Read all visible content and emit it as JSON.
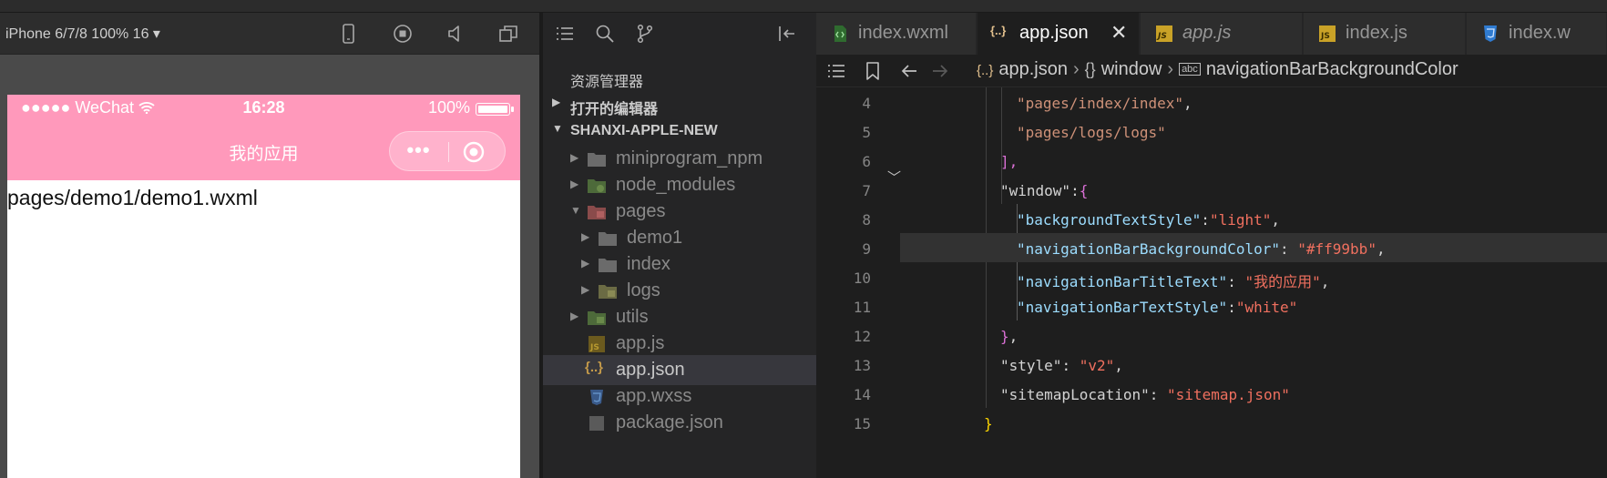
{
  "simulator": {
    "device": "iPhone 6/7/8 100% 16 ▾",
    "status_bar": {
      "signal": "●●●●● WeChat",
      "time": "16:28",
      "battery": "100%"
    },
    "nav_title": "我的应用",
    "page_text": "pages/demo1/demo1.wxml",
    "capsule": {
      "more": "•••"
    }
  },
  "explorer": {
    "title": "资源管理器",
    "open_editors": "打开的编辑器",
    "project": "SHANXI-APPLE-NEW",
    "tree": [
      {
        "label": "miniprogram_npm"
      },
      {
        "label": "node_modules"
      },
      {
        "label": "pages"
      },
      {
        "label": "demo1"
      },
      {
        "label": "index"
      },
      {
        "label": "logs"
      },
      {
        "label": "utils"
      },
      {
        "label": "app.js"
      },
      {
        "label": "app.json"
      },
      {
        "label": "app.wxss"
      },
      {
        "label": "package.json"
      }
    ]
  },
  "editor": {
    "tabs": [
      {
        "label": "index.wxml"
      },
      {
        "label": "app.json"
      },
      {
        "label": "app.js"
      },
      {
        "label": "index.js"
      },
      {
        "label": "index.w"
      }
    ],
    "breadcrumb": [
      "app.json",
      "window",
      "navigationBarBackgroundColor"
    ],
    "lines": [
      {
        "n": "4",
        "parts": [
          {
            "t": "\"pages/index/index\"",
            "c": "s"
          },
          {
            "t": ",",
            "c": "p"
          }
        ]
      },
      {
        "n": "5",
        "parts": [
          {
            "t": "\"pages/logs/logs\"",
            "c": "s"
          }
        ]
      },
      {
        "n": "6",
        "parts": [
          {
            "t": "],",
            "c": "br2"
          }
        ]
      },
      {
        "n": "7",
        "parts": [
          {
            "t": "\"window\"",
            "c": "p"
          },
          {
            "t": ":",
            "c": "p"
          },
          {
            "t": "{",
            "c": "br2"
          }
        ]
      },
      {
        "n": "8",
        "parts": [
          {
            "t": "\"backgroundTextStyle\"",
            "c": "k"
          },
          {
            "t": ":",
            "c": "p"
          },
          {
            "t": "\"light\"",
            "c": "s2"
          },
          {
            "t": ",",
            "c": "p"
          }
        ]
      },
      {
        "n": "9",
        "parts": [
          {
            "t": "\"navigationBarBackgroundColor\"",
            "c": "k"
          },
          {
            "t": ": ",
            "c": "p"
          },
          {
            "t": "\"#ff99bb\"",
            "c": "s2"
          },
          {
            "t": ",",
            "c": "p"
          }
        ]
      },
      {
        "n": "10",
        "parts": [
          {
            "t": "\"navigationBarTitleText\"",
            "c": "k"
          },
          {
            "t": ": ",
            "c": "p"
          },
          {
            "t": "\"我的应用\"",
            "c": "s2"
          },
          {
            "t": ",",
            "c": "p"
          }
        ]
      },
      {
        "n": "11",
        "parts": [
          {
            "t": "\"navigationBarTextStyle\"",
            "c": "k"
          },
          {
            "t": ":",
            "c": "p"
          },
          {
            "t": "\"white\"",
            "c": "s2"
          }
        ]
      },
      {
        "n": "12",
        "parts": [
          {
            "t": "}",
            "c": "br2"
          },
          {
            "t": ",",
            "c": "p"
          }
        ]
      },
      {
        "n": "13",
        "parts": [
          {
            "t": "\"style\"",
            "c": "p"
          },
          {
            "t": ": ",
            "c": "p"
          },
          {
            "t": "\"v2\"",
            "c": "s2"
          },
          {
            "t": ",",
            "c": "p"
          }
        ]
      },
      {
        "n": "14",
        "parts": [
          {
            "t": "\"sitemapLocation\"",
            "c": "p"
          },
          {
            "t": ": ",
            "c": "p"
          },
          {
            "t": "\"sitemap.json\"",
            "c": "s2"
          }
        ]
      },
      {
        "n": "15",
        "parts": [
          {
            "t": "}",
            "c": "br"
          }
        ]
      }
    ]
  },
  "colors": {
    "nav_bar": "#ff99bb",
    "editor_bg": "#1e1e1e",
    "sidebar_bg": "#252526",
    "string": "#ce9178",
    "key": "#9cdcfe"
  }
}
